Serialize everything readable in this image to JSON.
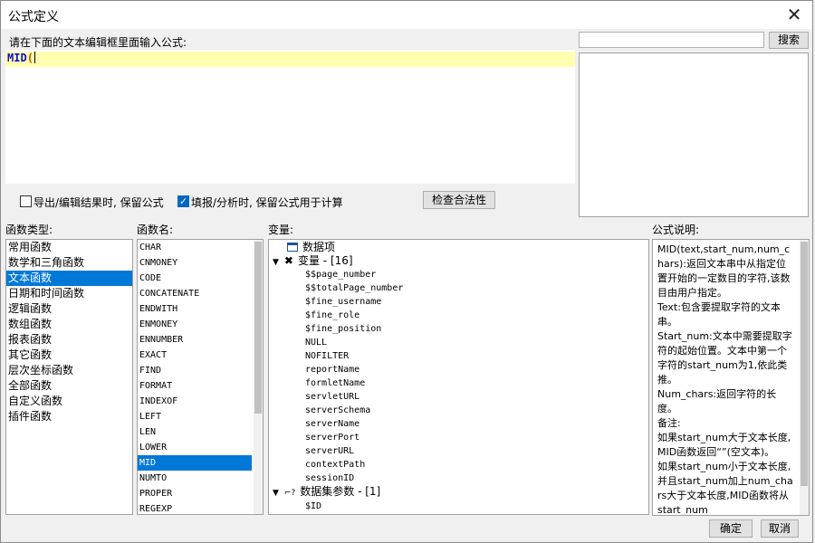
{
  "window": {
    "title": "公式定义"
  },
  "editor": {
    "prompt": "请在下面的文本编辑框里面输入公式:",
    "formula_fn": "MID",
    "formula_paren": "("
  },
  "search": {
    "value": "",
    "button": "搜索"
  },
  "options": {
    "keep_formula_export": {
      "label": "导出/编辑结果时, 保留公式",
      "checked": false
    },
    "keep_formula_fill": {
      "label": "填报/分析时, 保留公式用于计算",
      "checked": true
    },
    "check_button": "检查合法性"
  },
  "categories": {
    "header": "函数类型:",
    "items": [
      "常用函数",
      "数学和三角函数",
      "文本函数",
      "日期和时间函数",
      "逻辑函数",
      "数组函数",
      "报表函数",
      "其它函数",
      "层次坐标函数",
      "全部函数",
      "自定义函数",
      "插件函数"
    ],
    "selected": 2
  },
  "functions": {
    "header": "函数名:",
    "items": [
      "CHAR",
      "CNMONEY",
      "CODE",
      "CONCATENATE",
      "ENDWITH",
      "ENMONEY",
      "ENNUMBER",
      "EXACT",
      "FIND",
      "FORMAT",
      "INDEXOF",
      "LEFT",
      "LEN",
      "LOWER",
      "MID",
      "NUMTO",
      "PROPER",
      "REGEXP"
    ],
    "selected": 14
  },
  "variables": {
    "header": "变量:",
    "data_item": "数据项",
    "var_group": "变量 - [16]",
    "vars": [
      "$$page_number",
      "$$totalPage_number",
      "$fine_username",
      "$fine_role",
      "$fine_position",
      "NULL",
      "NOFILTER",
      "reportName",
      "formletName",
      "servletURL",
      "serverSchema",
      "serverName",
      "serverPort",
      "serverURL",
      "contextPath",
      "sessionID"
    ],
    "dataset_group": "数据集参数 - [1]",
    "dataset_params": [
      "$ID"
    ]
  },
  "description": {
    "header": "公式说明:",
    "paragraphs": [
      "MID(text,start_num,num_chars):返回文本串中从指定位置开始的一定数目的字符,该数目由用户指定。",
      "Text:包含要提取字符的文本串。",
      "Start_num:文本中需要提取字符的起始位置。文本中第一个字符的start_num为1,依此类推。",
      "Num_chars:返回字符的长度。",
      "备注:",
      "如果start_num大于文本长度,MID函数返回“”(空文本)。",
      "如果start_num小于文本长度,并且start_num加上num_chars大于文本长度,MID函数将从start_num"
    ]
  },
  "footer": {
    "ok": "确定",
    "cancel": "取消"
  },
  "colors": {
    "selection": "#0078d7",
    "editor_line": "#ffffb0",
    "function_text": "#1010c0"
  }
}
